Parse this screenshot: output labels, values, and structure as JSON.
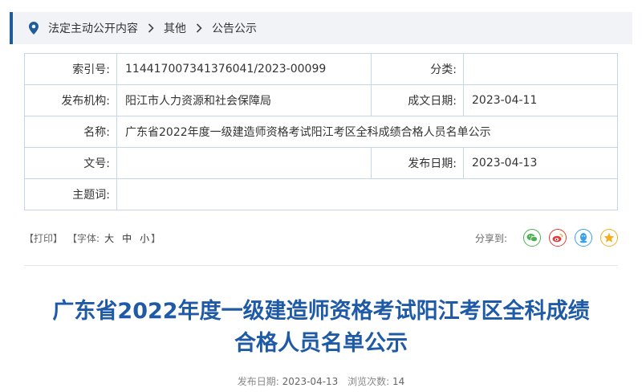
{
  "breadcrumb": [
    "法定主动公开内容",
    "其他",
    "公告公示"
  ],
  "info": {
    "index_label": "索引号:",
    "index_value": "114417007341376041/2023-00099",
    "category_label": "分类:",
    "category_value": "",
    "publisher_label": "发布机构:",
    "publisher_value": "阳江市人力资源和社会保障局",
    "created_label": "成文日期:",
    "created_value": "2023-04-11",
    "name_label": "名称:",
    "name_value": "广东省2022年度一级建造师资格考试阳江考区全科成绩合格人员名单公示",
    "docno_label": "文号:",
    "docno_value": "",
    "pubdate_label": "发布日期:",
    "pubdate_value": "2023-04-13",
    "subject_label": "主题词:",
    "subject_value": ""
  },
  "tools": {
    "print": "【打印】",
    "font_open": "【字体:",
    "font_large": "大",
    "font_medium": "中",
    "font_small": "小",
    "font_close": "】",
    "share_label": "分享到:"
  },
  "article": {
    "title_line1": "广东省2022年度一级建造师资格考试阳江考区全科成绩",
    "title_line2": "合格人员名单公示",
    "pubdate_label": "发布日期:",
    "pubdate_value": "2023-04-13",
    "views_label": "浏览次数:",
    "views_value": "14"
  },
  "colors": {
    "accent": "#1f5c99",
    "title": "#1f5aa6",
    "wechat": "#4caf50",
    "weibo": "#e4393c",
    "qq": "#3aa0e8",
    "qzone": "#f2b01e"
  }
}
